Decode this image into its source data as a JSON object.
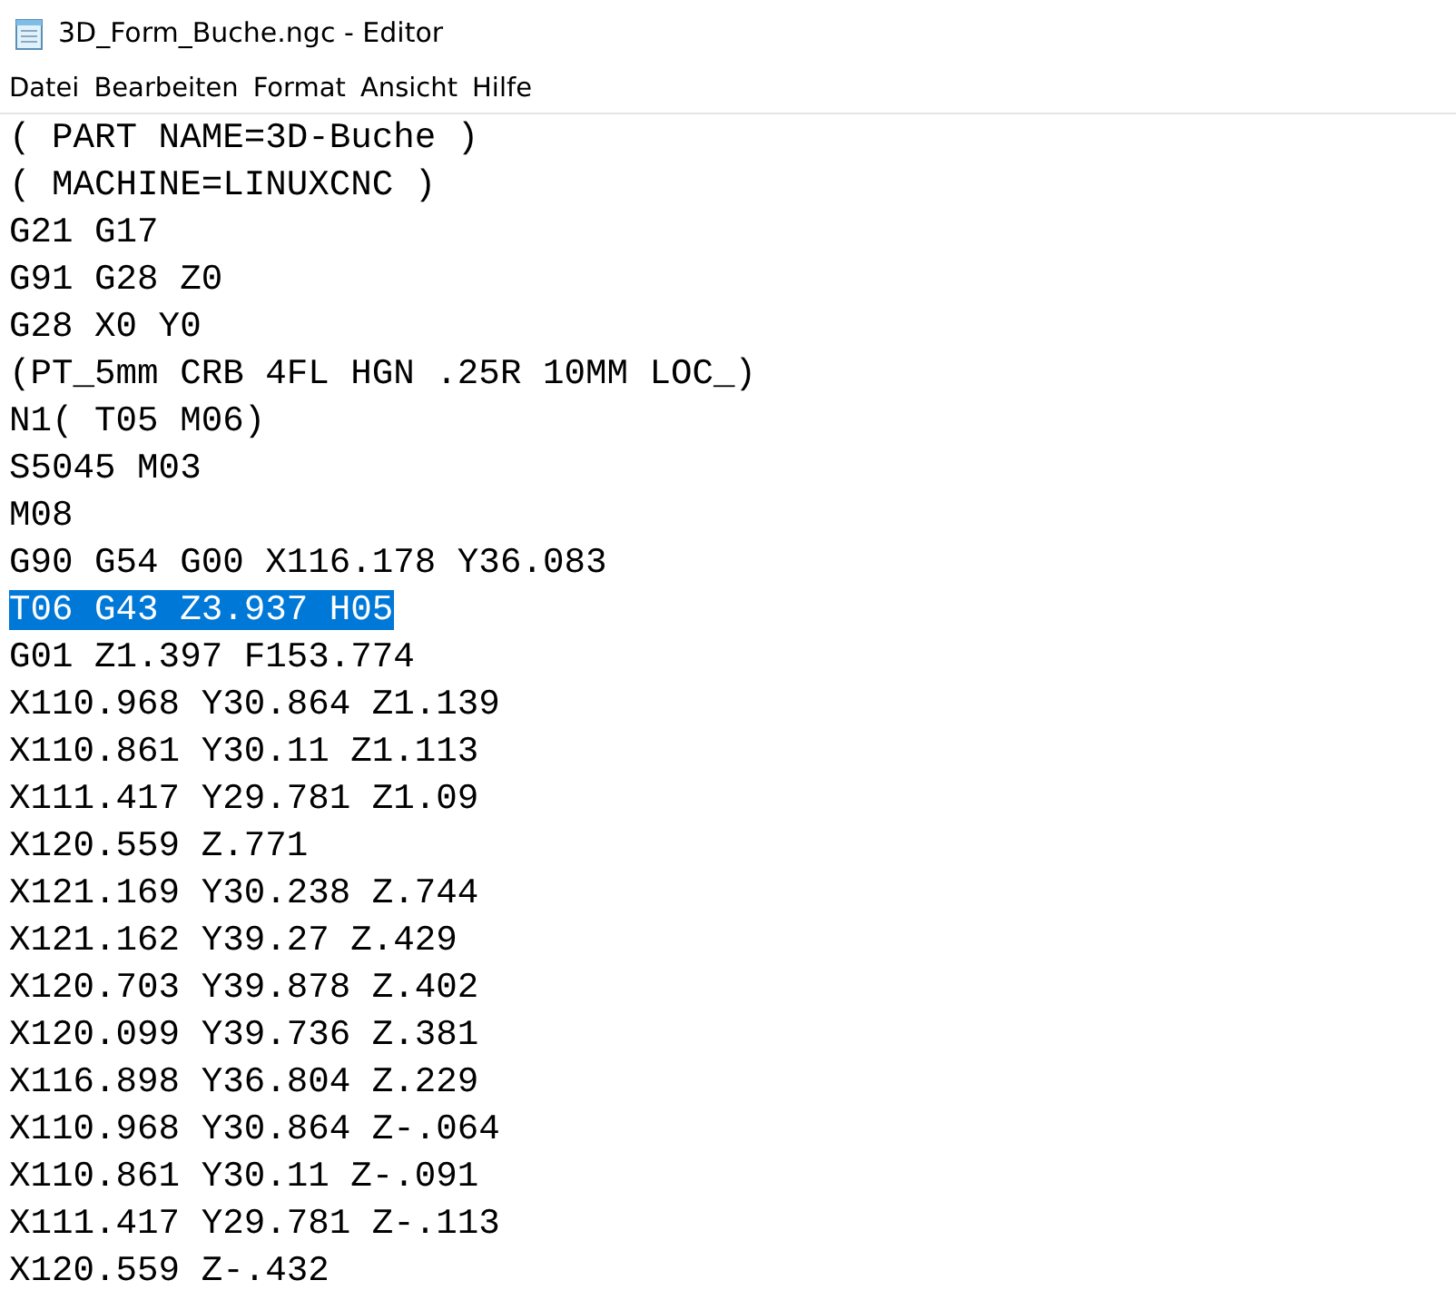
{
  "window": {
    "title": "3D_Form_Buche.ngc - Editor"
  },
  "menu": [
    "Datei",
    "Bearbeiten",
    "Format",
    "Ansicht",
    "Hilfe"
  ],
  "lines": [
    {
      "text": "( PART NAME=3D-Buche )",
      "selected": false
    },
    {
      "text": "( MACHINE=LINUXCNC )",
      "selected": false
    },
    {
      "text": "G21 G17",
      "selected": false
    },
    {
      "text": "G91 G28 Z0",
      "selected": false
    },
    {
      "text": "G28 X0 Y0",
      "selected": false
    },
    {
      "text": "(PT_5mm CRB 4FL HGN .25R 10MM LOC_)",
      "selected": false
    },
    {
      "text": "N1( T05 M06)",
      "selected": false
    },
    {
      "text": "S5045 M03",
      "selected": false
    },
    {
      "text": "M08",
      "selected": false
    },
    {
      "text": "G90 G54 G00 X116.178 Y36.083",
      "selected": false
    },
    {
      "text": "T06 G43 Z3.937 H05",
      "selected": true
    },
    {
      "text": "G01 Z1.397 F153.774",
      "selected": false
    },
    {
      "text": "X110.968 Y30.864 Z1.139",
      "selected": false
    },
    {
      "text": "X110.861 Y30.11 Z1.113",
      "selected": false
    },
    {
      "text": "X111.417 Y29.781 Z1.09",
      "selected": false
    },
    {
      "text": "X120.559 Z.771",
      "selected": false
    },
    {
      "text": "X121.169 Y30.238 Z.744",
      "selected": false
    },
    {
      "text": "X121.162 Y39.27 Z.429",
      "selected": false
    },
    {
      "text": "X120.703 Y39.878 Z.402",
      "selected": false
    },
    {
      "text": "X120.099 Y39.736 Z.381",
      "selected": false
    },
    {
      "text": "X116.898 Y36.804 Z.229",
      "selected": false
    },
    {
      "text": "X110.968 Y30.864 Z-.064",
      "selected": false
    },
    {
      "text": "X110.861 Y30.11 Z-.091",
      "selected": false
    },
    {
      "text": "X111.417 Y29.781 Z-.113",
      "selected": false
    },
    {
      "text": "X120.559 Z-.432",
      "selected": false
    }
  ]
}
